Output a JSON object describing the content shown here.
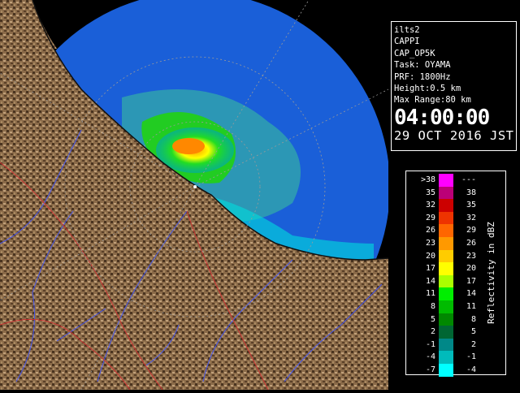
{
  "info": {
    "lines": [
      "ilts2",
      "CAPPI",
      "CAP_OP5K",
      "Task: OYAMA",
      "PRF: 1800Hz",
      "Height:0.5 km",
      "Max Range:80 km"
    ],
    "time": "04:00:00",
    "date": "29 OCT 2016 JST"
  },
  "legend": {
    "unit_label": "Reflectivity in dBZ",
    "rows": [
      {
        "lo": ">38",
        "hi": "---",
        "color": "#ff00ff"
      },
      {
        "lo": "35",
        "hi": "38",
        "color": "#bb0077"
      },
      {
        "lo": "32",
        "hi": "35",
        "color": "#cc0000"
      },
      {
        "lo": "29",
        "hi": "32",
        "color": "#ee3300"
      },
      {
        "lo": "26",
        "hi": "29",
        "color": "#ff6600"
      },
      {
        "lo": "23",
        "hi": "26",
        "color": "#ff9900"
      },
      {
        "lo": "20",
        "hi": "23",
        "color": "#ffcc00"
      },
      {
        "lo": "17",
        "hi": "20",
        "color": "#ffff00"
      },
      {
        "lo": "14",
        "hi": "17",
        "color": "#aaff00"
      },
      {
        "lo": "11",
        "hi": "14",
        "color": "#00ee00"
      },
      {
        "lo": "8",
        "hi": "11",
        "color": "#00bb00"
      },
      {
        "lo": "5",
        "hi": "8",
        "color": "#008800"
      },
      {
        "lo": "2",
        "hi": "5",
        "color": "#006633"
      },
      {
        "lo": "-1",
        "hi": "2",
        "color": "#008888"
      },
      {
        "lo": "-4",
        "hi": "-1",
        "color": "#00bbbb"
      },
      {
        "lo": "-7",
        "hi": "-4",
        "color": "#00ffff"
      }
    ]
  },
  "map": {
    "colors": {
      "land_dark": "#3a2a1a",
      "land_light": "#b09068",
      "sea": "#1a66dd",
      "rivers": "#4455ee",
      "borders": "#cc3333",
      "range_rings": "#888888"
    }
  }
}
